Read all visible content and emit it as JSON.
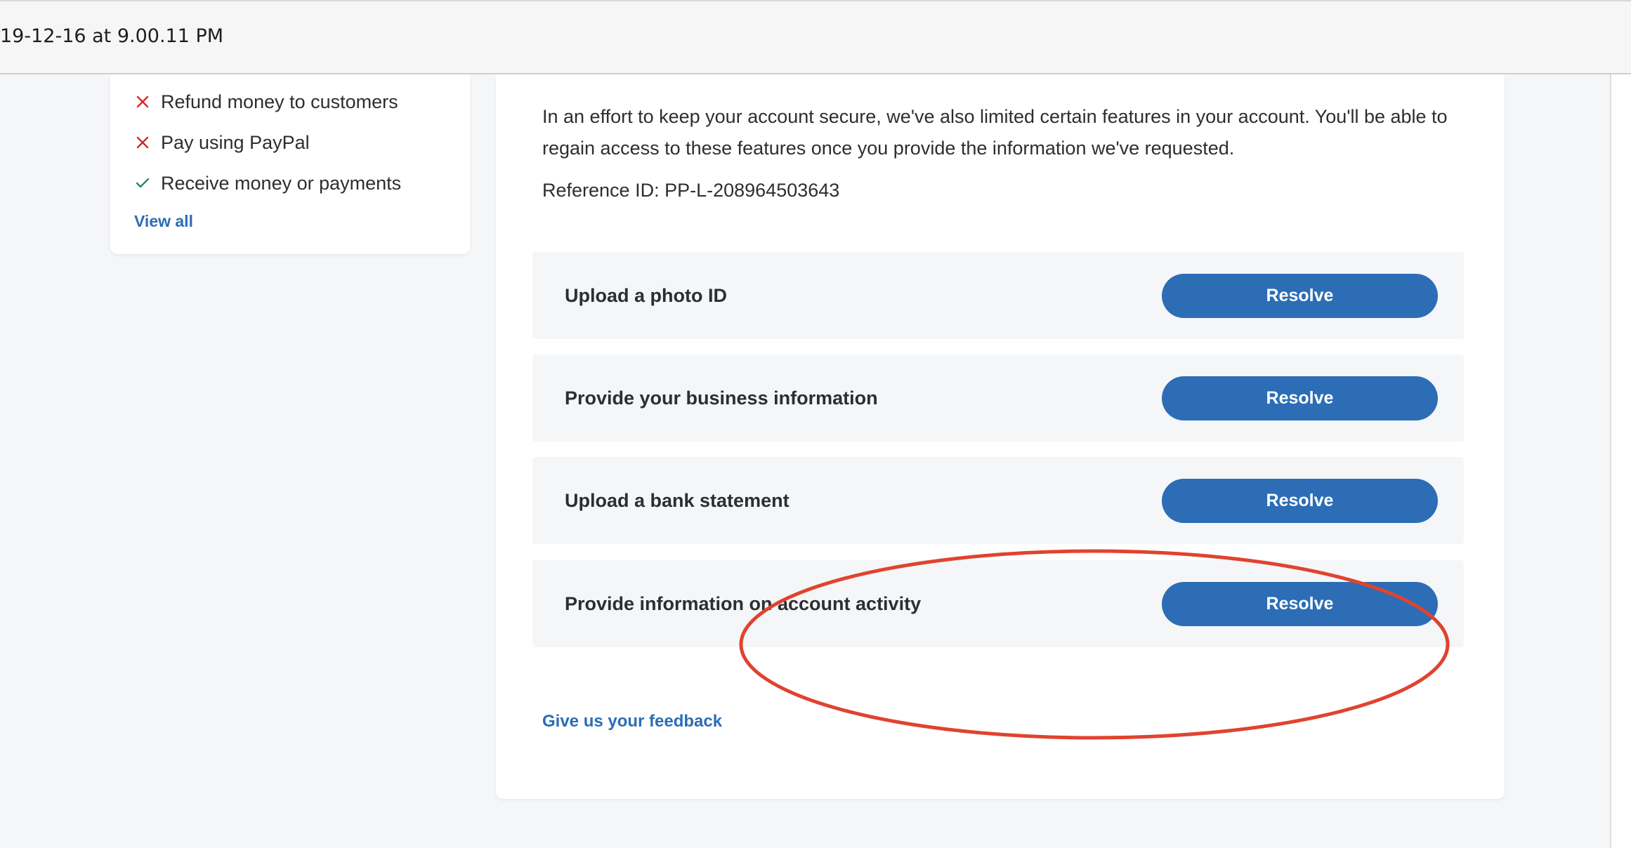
{
  "viewer": {
    "title": "19-12-16 at 9.00.11 PM"
  },
  "sidebar": {
    "features": [
      {
        "status": "limited",
        "icon": "x-mark-icon",
        "label": "Refund money to customers"
      },
      {
        "status": "limited",
        "icon": "x-mark-icon",
        "label": "Pay using PayPal"
      },
      {
        "status": "allowed",
        "icon": "check-mark-icon",
        "label": "Receive money or payments"
      }
    ],
    "view_all": "View all"
  },
  "main": {
    "info_text": "In an effort to keep your account secure, we've also limited certain features in your account. You'll be able to regain access to these features once you provide the information we've requested.",
    "reference": "Reference ID: PP-L-208964503643",
    "tasks": [
      {
        "label": "Upload a photo ID",
        "button": "Resolve"
      },
      {
        "label": "Provide your business information",
        "button": "Resolve"
      },
      {
        "label": "Upload a bank statement",
        "button": "Resolve"
      },
      {
        "label": "Provide information on account activity",
        "button": "Resolve"
      }
    ],
    "feedback": "Give us your feedback"
  },
  "colors": {
    "accent_blue": "#2c6db5",
    "limited_red": "#d9262c",
    "allowed_green": "#2b8a64",
    "annotation_red": "#e0432f"
  }
}
